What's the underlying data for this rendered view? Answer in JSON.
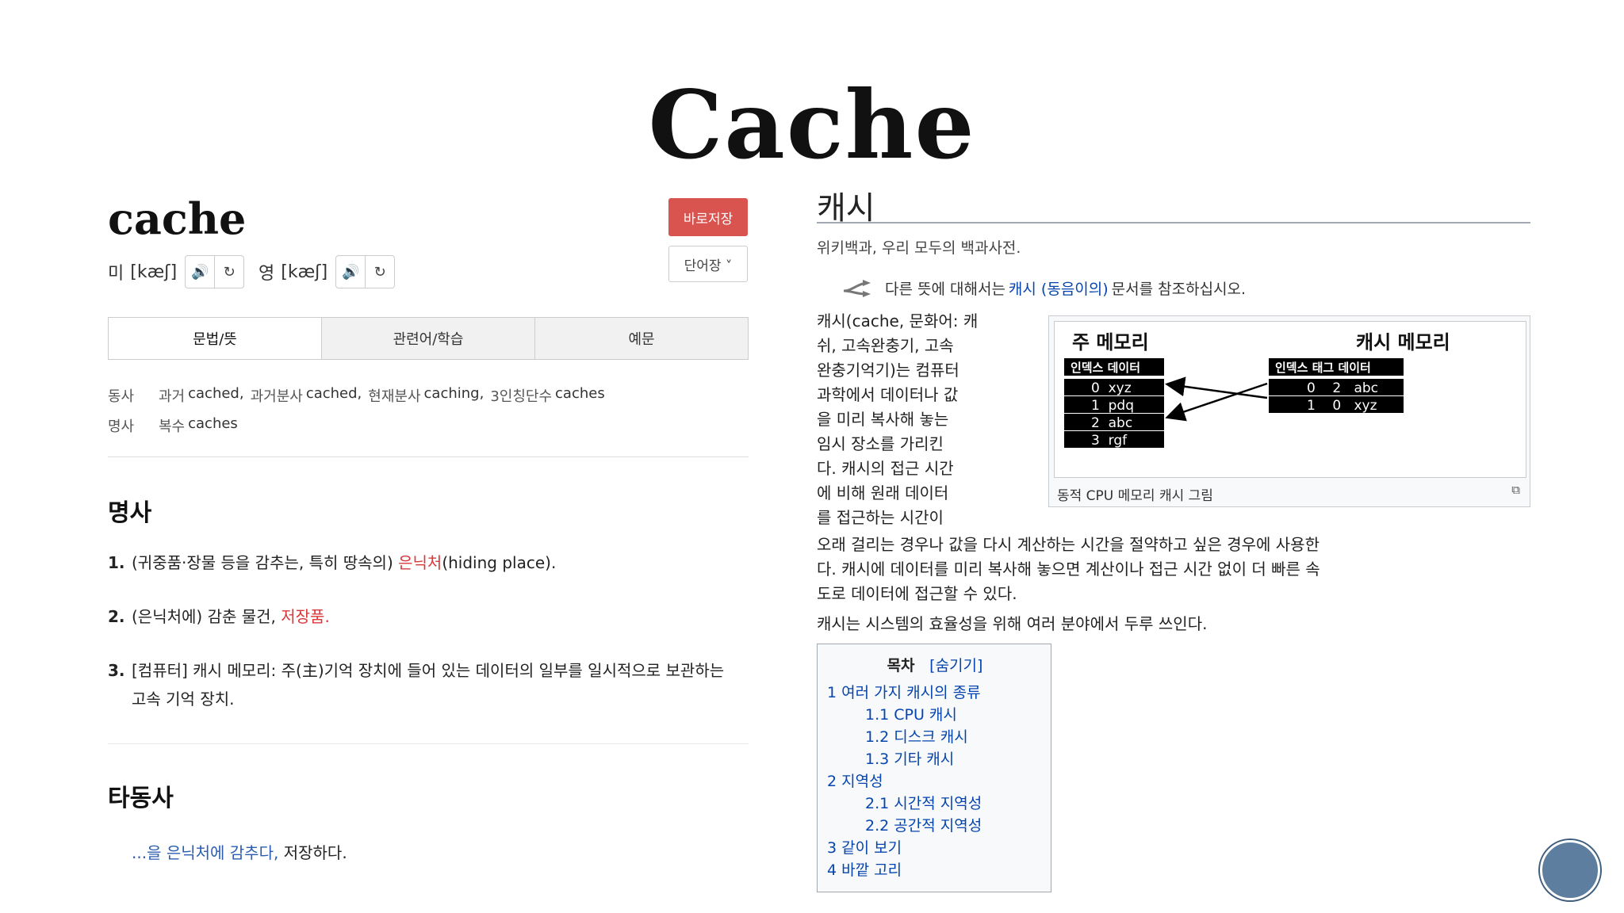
{
  "slide": {
    "title": "Cache"
  },
  "dict": {
    "word": "cache",
    "pron": [
      {
        "label": "미",
        "ipa": "[kæʃ]"
      },
      {
        "label": "영",
        "ipa": "[kæʃ]"
      }
    ],
    "save_label": "바로저장",
    "vocab_label": "단어장 ˅",
    "tabs": [
      "문법/뜻",
      "관련어/학습",
      "예문"
    ],
    "forms": [
      {
        "pos": "동사",
        "items": [
          {
            "k": "과거",
            "v": "cached,"
          },
          {
            "k": "과거분사",
            "v": "cached,"
          },
          {
            "k": "현재분사",
            "v": "caching,"
          },
          {
            "k": "3인칭단수",
            "v": "caches"
          }
        ]
      },
      {
        "pos": "명사",
        "items": [
          {
            "k": "복수",
            "v": "caches"
          }
        ]
      }
    ],
    "noun_heading": "명사",
    "defs": [
      {
        "num": "1.",
        "pre": "(귀중품·장물 등을 감추는, 특히 땅속의) ",
        "hl": "은닉처",
        "post": "(hiding place)."
      },
      {
        "num": "2.",
        "pre": "(은닉처에) 감춘 물건, ",
        "hl": "저장품.",
        "post": ""
      },
      {
        "num": "3.",
        "pre": "[컴퓨터] 캐시 메모리: 주(主)기억 장치에 들어 있는 데이터의 일부를 일시적으로 보관하는 고속 기억 장치.",
        "hl": "",
        "post": ""
      }
    ],
    "verb_heading": "타동사",
    "verb_link": "...을 은닉처에 감추다,",
    "verb_plain": " 저장하다."
  },
  "wiki": {
    "title": "캐시",
    "tagline": "위키백과, 우리 모두의 백과사전.",
    "hatnote_pre": "다른 뜻에 대해서는 ",
    "hatnote_link": "캐시 (동음이의)",
    "hatnote_post": " 문서를 참조하십시오.",
    "intro_lines": [
      "캐시(cache, 문화어: 캐",
      "쉬, 고속완충기, 고속",
      "완충기억기)는 컴퓨터",
      "과학에서 데이터나 값",
      "을 미리 복사해 놓는",
      "임시 장소를 가리킨",
      "다. 캐시의 접근 시간",
      "에 비해 원래 데이터",
      "를 접근하는 시간이"
    ],
    "intro_rest_lines": [
      "오래 걸리는 경우나 값을 다시 계산하는 시간을 절약하고 싶은 경우에 사용한",
      "다. 캐시에 데이터를 미리 복사해 놓으면 계산이나 접근 시간 없이 더 빠른 속",
      "도로 데이터에 접근할 수 있다."
    ],
    "para2": "캐시는 시스템의 효율성을 위해 여러 분야에서 두루 쓰인다.",
    "figure": {
      "main_title": "주 메모리",
      "cache_title": "캐시 메모리",
      "main_header": "인덱스 데이터",
      "cache_header": "인덱스 태그 데이터",
      "main_rows": [
        "0  xyz",
        "1  pdq",
        "2  abc",
        "3  rgf"
      ],
      "cache_rows": [
        "0    2   abc",
        "1    0   xyz"
      ],
      "caption": "동적 CPU 메모리 캐시 그림"
    },
    "toc": {
      "title": "목차",
      "toggle": "[숨기기]",
      "items": [
        {
          "text": "1 여러 가지 캐시의 종류",
          "level": 1
        },
        {
          "text": "1.1 CPU 캐시",
          "level": 2
        },
        {
          "text": "1.2 디스크 캐시",
          "level": 2
        },
        {
          "text": "1.3 기타 캐시",
          "level": 2
        },
        {
          "text": "2 지역성",
          "level": 1
        },
        {
          "text": "2.1 시간적 지역성",
          "level": 2
        },
        {
          "text": "2.2 공간적 지역성",
          "level": 2
        },
        {
          "text": "3 같이 보기",
          "level": 1
        },
        {
          "text": "4 바깥 고리",
          "level": 1
        }
      ]
    }
  }
}
